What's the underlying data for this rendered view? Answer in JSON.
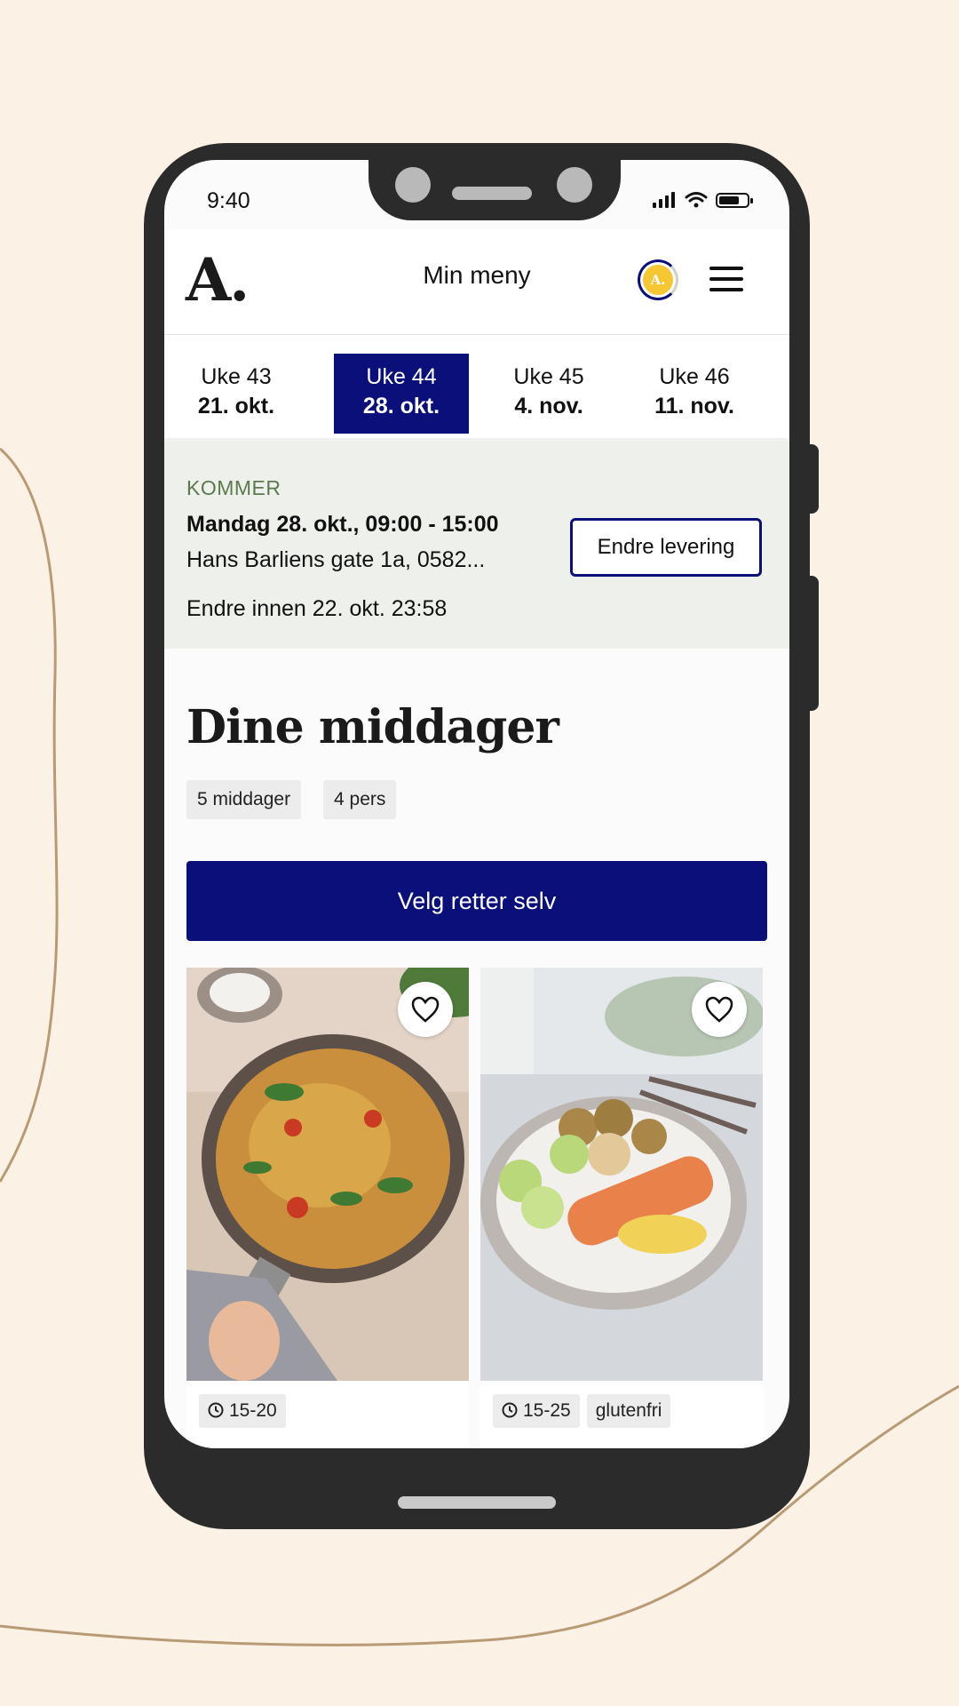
{
  "status_bar": {
    "time": "9:40"
  },
  "header": {
    "logo": "A.",
    "title": "Min meny",
    "avatar_initial": "A."
  },
  "weeks": [
    {
      "week": "Uke 43",
      "date": "21. okt.",
      "active": false
    },
    {
      "week": "Uke 44",
      "date": "28. okt.",
      "active": true
    },
    {
      "week": "Uke 45",
      "date": "4. nov.",
      "active": false
    },
    {
      "week": "Uke 46",
      "date": "11. nov.",
      "active": false
    }
  ],
  "delivery": {
    "status": "KOMMER",
    "date_time": "Mandag 28. okt., 09:00 - 15:00",
    "address": "Hans Barliens gate 1a, 0582...",
    "deadline": "Endre innen 22. okt. 23:58",
    "change_button": "Endre levering"
  },
  "dinners": {
    "title": "Dine middager",
    "chips": [
      "5 middager",
      "4 pers"
    ],
    "choose_button": "Velg retter selv"
  },
  "cards": [
    {
      "time": "15-20",
      "tags": [],
      "stars": "★★★★★"
    },
    {
      "time": "15-25",
      "tags": [
        "glutenfri"
      ],
      "stars": "★★★★★"
    }
  ],
  "colors": {
    "accent": "#0a0f7a",
    "background": "#fbf1e5",
    "status_green": "#5c7a4b",
    "avatar_yellow": "#f6c633"
  }
}
